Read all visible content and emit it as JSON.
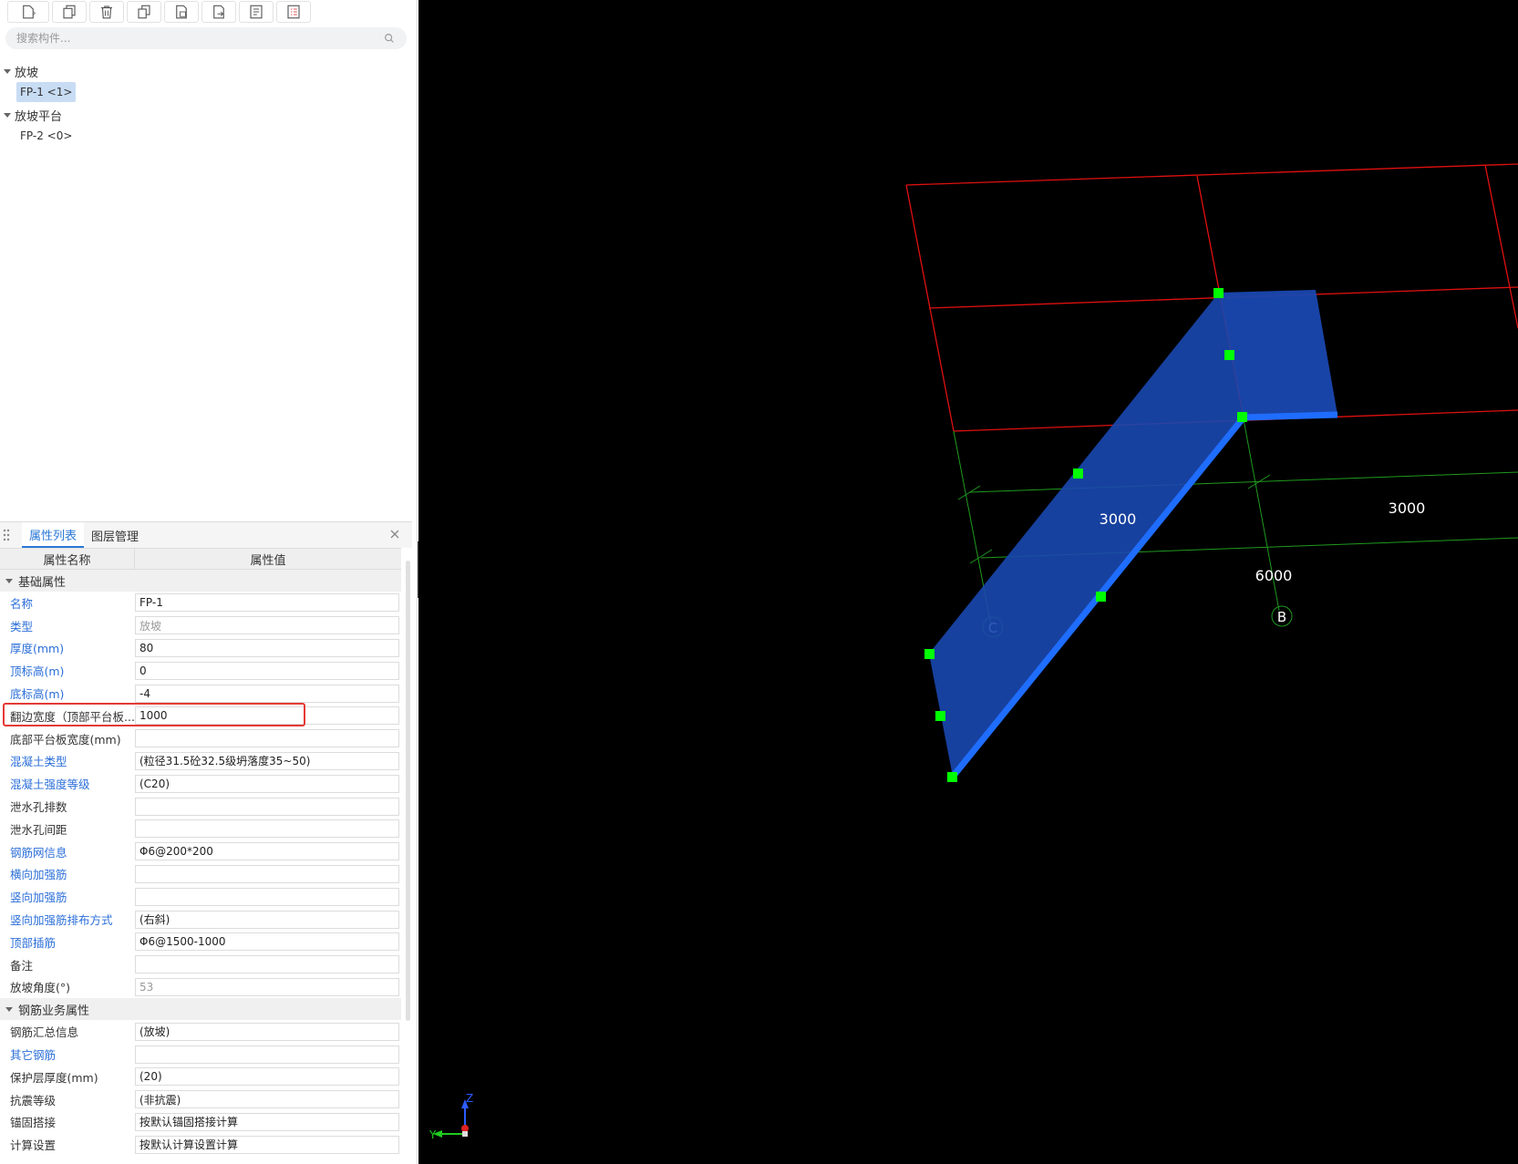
{
  "search": {
    "placeholder": "搜索构件..."
  },
  "tree": {
    "groups": [
      {
        "label": "放坡",
        "items": [
          {
            "label": "FP-1 <1>",
            "selected": true
          }
        ]
      },
      {
        "label": "放坡平台",
        "items": [
          {
            "label": "FP-2 <0>",
            "selected": false
          }
        ]
      }
    ]
  },
  "props": {
    "tabs": [
      {
        "label": "属性列表",
        "active": true
      },
      {
        "label": "图层管理",
        "active": false
      }
    ],
    "head": {
      "name": "属性名称",
      "value": "属性值"
    },
    "sections": [
      {
        "title": "基础属性",
        "rows": [
          {
            "name": "名称",
            "value": "FP-1",
            "blue": true,
            "gray": false
          },
          {
            "name": "类型",
            "value": "放坡",
            "blue": true,
            "gray": true
          },
          {
            "name": "厚度(mm)",
            "value": "80",
            "blue": true,
            "gray": false
          },
          {
            "name": "顶标高(m)",
            "value": "0",
            "blue": true,
            "gray": false
          },
          {
            "name": "底标高(m)",
            "value": "-4",
            "blue": true,
            "gray": false
          },
          {
            "name": "翻边宽度（顶部平台板...",
            "value": "1000",
            "blue": false,
            "gray": false
          },
          {
            "name": "底部平台板宽度(mm)",
            "value": "",
            "blue": false,
            "gray": false
          },
          {
            "name": "混凝土类型",
            "value": "(粒径31.5砼32.5级坍落度35~50)",
            "blue": true,
            "gray": false
          },
          {
            "name": "混凝土强度等级",
            "value": "(C20)",
            "blue": true,
            "gray": false
          },
          {
            "name": "泄水孔排数",
            "value": "",
            "blue": false,
            "gray": false
          },
          {
            "name": "泄水孔间距",
            "value": "",
            "blue": false,
            "gray": false
          },
          {
            "name": "钢筋网信息",
            "value": "Φ6@200*200",
            "blue": true,
            "gray": false
          },
          {
            "name": "横向加强筋",
            "value": "",
            "blue": true,
            "gray": false
          },
          {
            "name": "竖向加强筋",
            "value": "",
            "blue": true,
            "gray": false
          },
          {
            "name": "竖向加强筋排布方式",
            "value": "(右斜)",
            "blue": true,
            "gray": false
          },
          {
            "name": "顶部插筋",
            "value": "Φ6@1500-1000",
            "blue": true,
            "gray": false
          },
          {
            "name": "备注",
            "value": "",
            "blue": false,
            "gray": false
          },
          {
            "name": "放坡角度(°)",
            "value": "53",
            "blue": false,
            "gray": true
          }
        ]
      },
      {
        "title": "钢筋业务属性",
        "rows": [
          {
            "name": "钢筋汇总信息",
            "value": "(放坡)",
            "blue": false,
            "gray": false
          },
          {
            "name": "其它钢筋",
            "value": "",
            "blue": true,
            "gray": false
          },
          {
            "name": "保护层厚度(mm)",
            "value": "(20)",
            "blue": false,
            "gray": false
          },
          {
            "name": "抗震等级",
            "value": "(非抗震)",
            "blue": false,
            "gray": false
          },
          {
            "name": "锚固搭接",
            "value": "按默认锚固搭接计算",
            "blue": false,
            "gray": false
          },
          {
            "name": "计算设置",
            "value": "按默认计算设置计算",
            "blue": false,
            "gray": false
          }
        ]
      }
    ]
  },
  "viewport": {
    "dim_labels": [
      "3000",
      "3000",
      "6000"
    ],
    "axis_labels": [
      "C",
      "B"
    ],
    "axes": {
      "z": "Z",
      "y": "Y"
    },
    "colors": {
      "grid_red": "#e01010",
      "axis_green": "#1f9a1f",
      "slab": "#1a48b0",
      "edge": "#1f6dff",
      "handle": "#00ff00"
    }
  }
}
